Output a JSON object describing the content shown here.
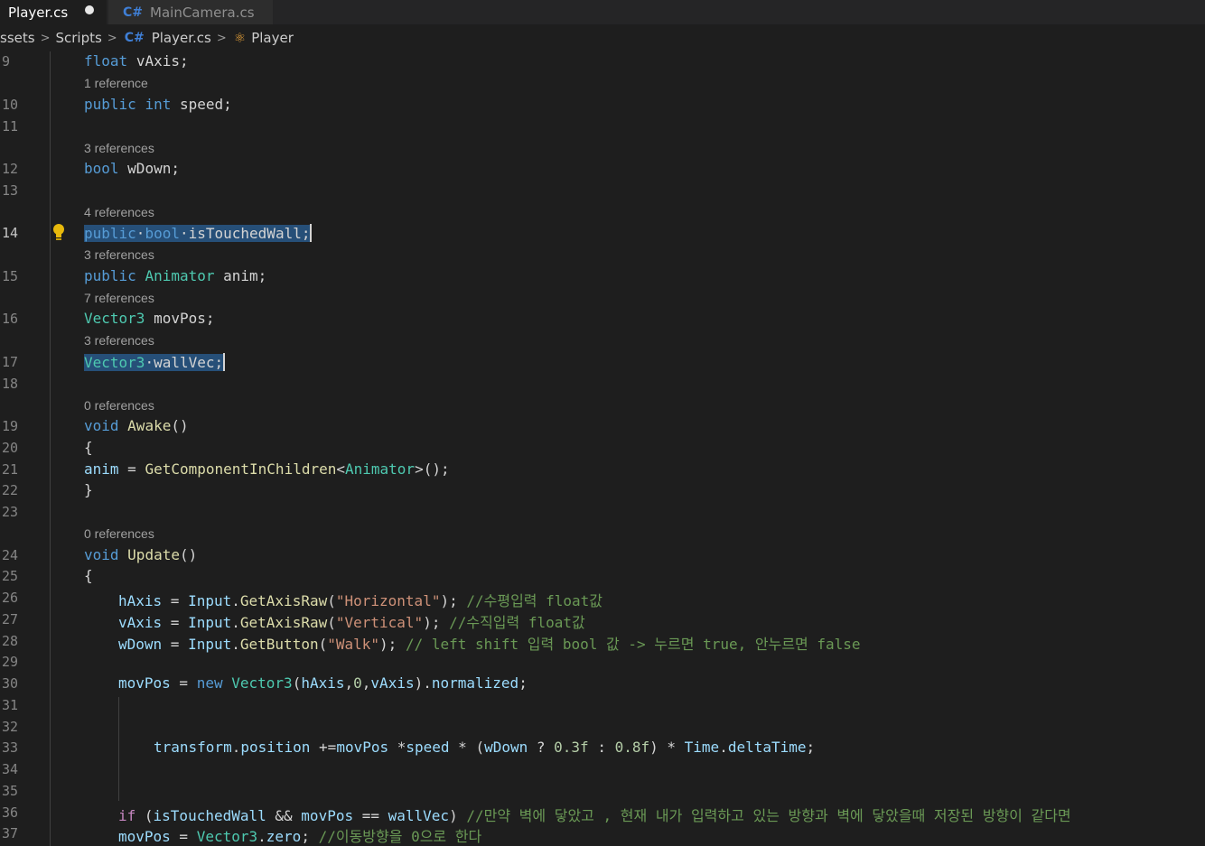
{
  "tabs": [
    {
      "label": "Player.cs",
      "modified": true
    },
    {
      "label": "MainCamera.cs",
      "icon": "csharp-icon"
    }
  ],
  "breadcrumb": {
    "items": [
      "ssets",
      "Scripts",
      "Player.cs",
      "Player"
    ]
  },
  "lines": {
    "l9": "9",
    "l10": "10",
    "l11": "11",
    "l12": "12",
    "l13": "13",
    "l14": "14",
    "l15": "15",
    "l16": "16",
    "l17": "17",
    "l18": "18",
    "l19": "19",
    "l20": "20",
    "l21": "21",
    "l22": "22",
    "l23": "23",
    "l24": "24",
    "l25": "25",
    "l26": "26",
    "l27": "27",
    "l28": "28",
    "l29": "29",
    "l30": "30",
    "l31": "31",
    "l32": "32",
    "l33": "33",
    "l34": "34",
    "l35": "35",
    "l36": "36",
    "l37": "37"
  },
  "codelens": {
    "r10": "1 reference",
    "r12": "3 references",
    "r14": "4 references",
    "r15": "3 references",
    "r16": "7 references",
    "r17": "3 references",
    "r19": "0 references",
    "r24": "0 references"
  },
  "tokens": {
    "float": "float",
    "vAxis": "vAxis",
    "semi": ";",
    "public": "public",
    "int": "int",
    "speed": "speed",
    "bool": "bool",
    "wDown": "wDown",
    "isTouchedWall": "isTouchedWall",
    "Animator": "Animator",
    "anim": "anim",
    "Vector3": "Vector3",
    "movPos": "movPos",
    "wallVec": "wallVec",
    "void": "void",
    "Awake": "Awake",
    "parens": "()",
    "lbrace": "{",
    "rbrace": "}",
    "assign": " = ",
    "GetComponentInChildren": "GetComponentInChildren",
    "lt": "<",
    "gt_call": ">();",
    "Update": "Update",
    "hAxis": "hAxis",
    "Input": "Input",
    "GetAxisRaw": "GetAxisRaw",
    "GetButton": "GetButton",
    "str_horizontal": "\"Horizontal\"",
    "str_vertical": "\"Vertical\"",
    "str_walk": "\"Walk\"",
    "cm26": "//수평입력 float값",
    "cm27": "//수직입력 float값",
    "cm28": "// left shift 입력 bool 값 -> 누르면 true, 안누르면 false",
    "new": "new",
    "zero_num": "0",
    "normalized": "normalized",
    "transform": "transform",
    "position": "position",
    "speed2": "speed",
    "num03": "0.3f",
    "num08": "0.8f",
    "Time": "Time",
    "deltaTime": "deltaTime",
    "if": "if",
    "and": " && ",
    "eq": " == ",
    "cm36": "//만약 벽에 닿았고 , 현재 내가 입력하고 있는 방향과 벽에 닿았을때 저장된 방향이 같다면",
    "zero": "zero",
    "cm37": "//이동방향을 0으로 한다"
  }
}
